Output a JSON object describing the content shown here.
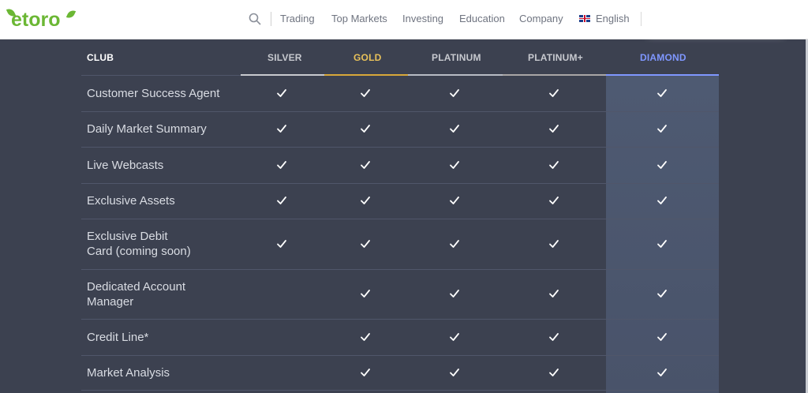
{
  "header": {
    "logo": "etoro",
    "nav": [
      "Trading",
      "Top Markets",
      "Investing",
      "Education",
      "Company"
    ],
    "language": "English",
    "icons": [
      "search-icon",
      "uk-flag-icon"
    ]
  },
  "table": {
    "columns": [
      {
        "label": "CLUB",
        "color": "#ffffff"
      },
      {
        "label": "SILVER",
        "color": "#c7c9cf",
        "underline": "#c8cace"
      },
      {
        "label": "GOLD",
        "color": "#e8c15a",
        "underline": "#d8a83a"
      },
      {
        "label": "PLATINUM",
        "color": "#c7c9cf",
        "underline": "#b8bcc4"
      },
      {
        "label": "PLATINUM+",
        "color": "#c7c9cf",
        "underline": "#a9a6a6"
      },
      {
        "label": "DIAMOND",
        "color": "#7f97ff",
        "underline": "#7f97ff"
      }
    ],
    "rows": [
      {
        "label": "Customer Success Agent",
        "checks": [
          true,
          true,
          true,
          true,
          true
        ]
      },
      {
        "label": "Daily Market Summary",
        "checks": [
          true,
          true,
          true,
          true,
          true
        ]
      },
      {
        "label": "Live Webcasts",
        "checks": [
          true,
          true,
          true,
          true,
          true
        ]
      },
      {
        "label": "Exclusive Assets",
        "checks": [
          true,
          true,
          true,
          true,
          true
        ]
      },
      {
        "label_line1": "Exclusive Debit",
        "label_line2": "Card (coming soon)",
        "checks": [
          true,
          true,
          true,
          true,
          true
        ]
      },
      {
        "label_line1": "Dedicated Account",
        "label_line2": "Manager",
        "checks": [
          false,
          true,
          true,
          true,
          true
        ]
      },
      {
        "label": "Credit Line*",
        "checks": [
          false,
          true,
          true,
          true,
          true
        ]
      },
      {
        "label": "Market Analysis",
        "checks": [
          false,
          true,
          true,
          true,
          true
        ]
      }
    ]
  },
  "colors": {
    "background": "#3c4150",
    "brand_green": "#6bb734",
    "check": "#ffffff"
  }
}
